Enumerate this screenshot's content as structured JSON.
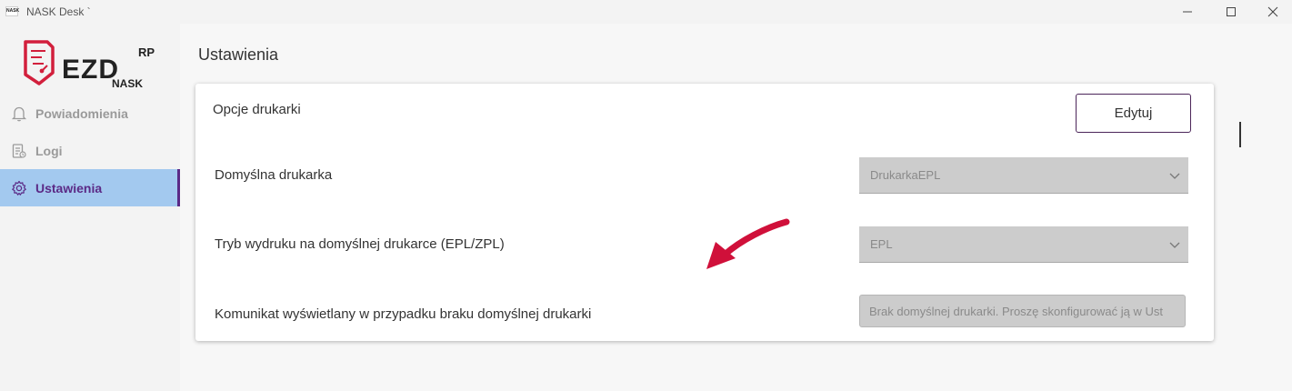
{
  "window": {
    "badge": "NASK",
    "title": "NASK Desk `"
  },
  "sidebar": {
    "logo": {
      "brand": "EZD",
      "superscript": "RP",
      "sub": "NASK"
    },
    "items": [
      {
        "label": "Powiadomienia",
        "icon": "bell-icon",
        "active": false
      },
      {
        "label": "Logi",
        "icon": "log-icon",
        "active": false
      },
      {
        "label": "Ustawienia",
        "icon": "gear-icon",
        "active": true
      }
    ]
  },
  "main": {
    "title": "Ustawienia",
    "card": {
      "title": "Opcje drukarki",
      "edit_label": "Edytuj",
      "fields": [
        {
          "label": "Domyślna drukarka",
          "value": "DrukarkaEPL",
          "type": "select"
        },
        {
          "label": "Tryb wydruku na domyślnej drukarce (EPL/ZPL)",
          "value": "EPL",
          "type": "select"
        },
        {
          "label": "Komunikat wyświetlany w przypadku braku domyślnej drukarki",
          "value": "Brak domyślnej drukarki. Proszę skonfigurować ją w Ust",
          "type": "text"
        }
      ]
    }
  },
  "colors": {
    "accent": "#5b2a86",
    "active_bg": "#a3c9ef",
    "logo_red": "#d21f3c",
    "annotation_arrow": "#d0103a",
    "disabled_field": "#cccccc"
  }
}
